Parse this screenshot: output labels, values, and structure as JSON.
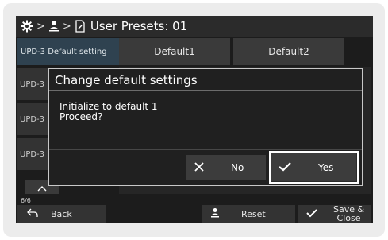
{
  "breadcrumb": {
    "title": "User Presets: 01",
    "icons": [
      "gear-icon",
      "user-icon",
      "document-icon"
    ],
    "separator": ">"
  },
  "tabs": [
    {
      "label": "UPD-3 Default setting"
    },
    {
      "label": "Default1"
    },
    {
      "label": "Default2"
    }
  ],
  "list_items": [
    "UPD-3",
    "UPD-3",
    "UPD-3"
  ],
  "pager": "6/6",
  "bottom": {
    "back_label": "Back",
    "reset_label": "Reset",
    "save_label_line1": "Save &",
    "save_label_line2": "Close"
  },
  "dialog": {
    "title": "Change default settings",
    "message_line1": "Initialize to default 1",
    "message_line2": "Proceed?",
    "no_label": "No",
    "yes_label": "Yes"
  },
  "colors": {
    "background": "#1c1c1c",
    "selected_tab": "#2f4250",
    "highlight": "#ffffff"
  }
}
